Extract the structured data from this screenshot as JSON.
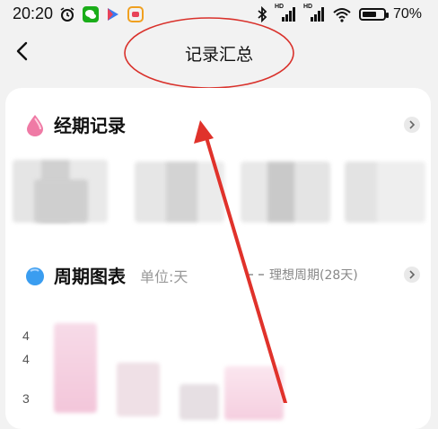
{
  "status_bar": {
    "time": "20:20",
    "battery": "70%",
    "battery_level": 0.7,
    "icons_left": [
      "alarm-icon",
      "wechat-icon",
      "play-icon",
      "app-icon"
    ],
    "icons_right": [
      "bluetooth-icon",
      "signal-hd-icon",
      "signal-hd-icon",
      "wifi-icon",
      "battery-icon"
    ],
    "hd_label": "HD"
  },
  "nav": {
    "title": "记录汇总",
    "back_icon": "back-chevron-icon"
  },
  "sections": {
    "period": {
      "title": "经期记录",
      "icon": "drop-icon",
      "icon_color": "#ef7aa5"
    },
    "chart": {
      "title": "周期图表",
      "unit": "单位:天",
      "ideal": "理想周期(28天)",
      "icon": "drop-icon",
      "icon_color": "#3a9df0"
    }
  },
  "axis": [
    "4",
    "4",
    "3"
  ],
  "colors": {
    "annotation": "#e0322b",
    "pink": "#f7cfe0",
    "gray_blur": "#dcdcdc"
  }
}
